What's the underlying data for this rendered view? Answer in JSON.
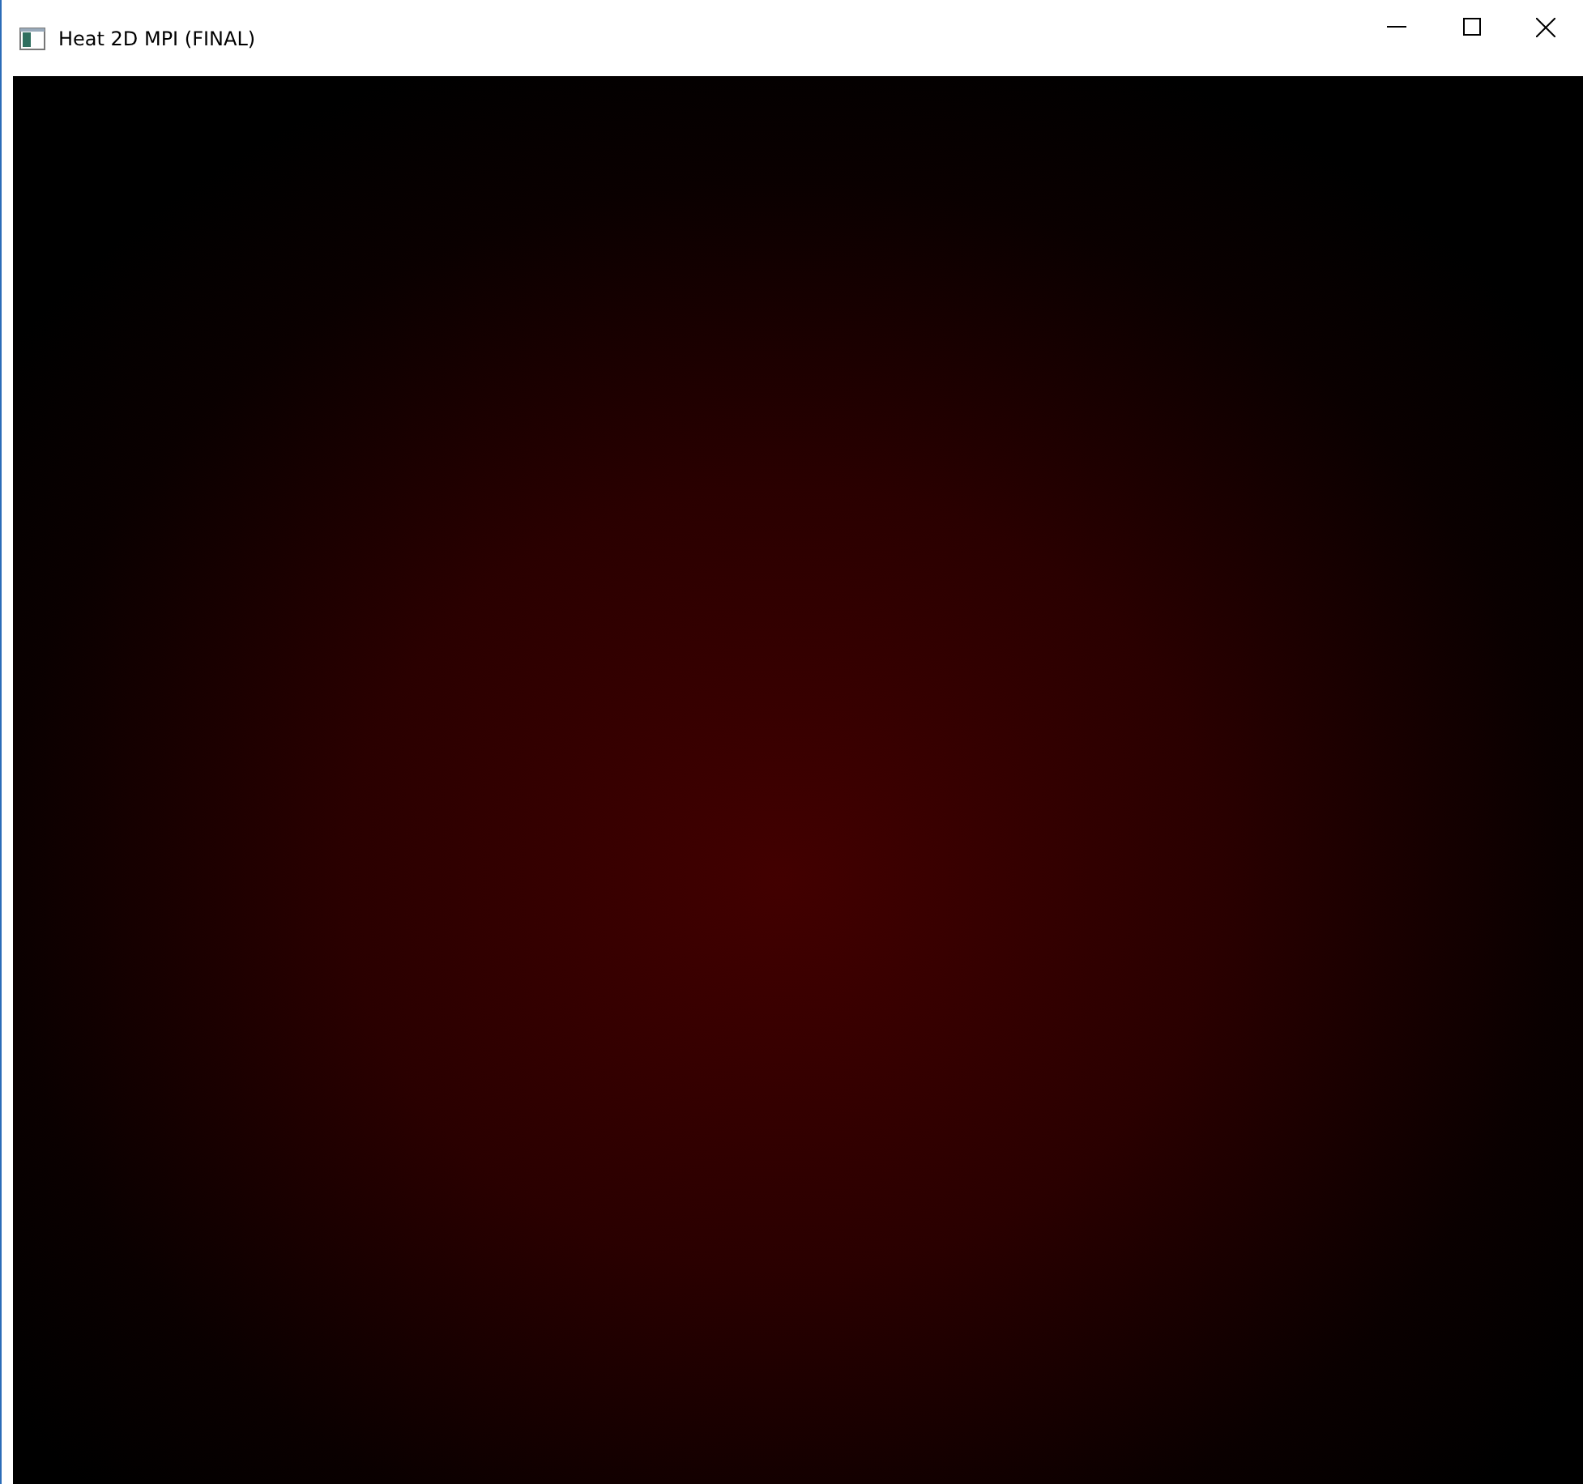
{
  "window": {
    "title": "Heat 2D MPI (FINAL)"
  }
}
